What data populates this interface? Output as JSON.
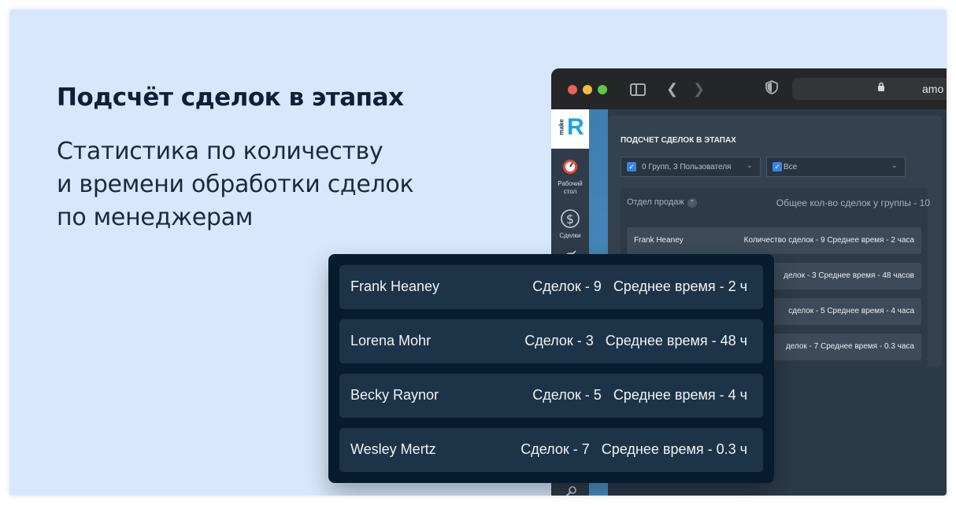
{
  "hero": {
    "title": "Подсчёт сделок в этапах",
    "subtitle_lines": [
      "Статистика по количеству",
      "и времени обработки сделок",
      "по менеджерам"
    ]
  },
  "browser": {
    "url": "amo",
    "nav": {
      "logo_prefix": "make",
      "logo_letter": "R",
      "items": [
        {
          "label": "Рабочий стол",
          "icon": "dashboard-icon"
        },
        {
          "label": "Сделки",
          "icon": "dollar-icon"
        }
      ]
    },
    "widget": {
      "title": "ПОДСЧЕТ СДЕЛОК В ЭТАПАХ",
      "filter_groups": "0 Групп, 3 Пользователя",
      "filter_all": "Все",
      "group_name": "Отдел продаж",
      "group_total": "Общее кол-во сделок у группы - 10",
      "rows": [
        {
          "name": "Frank Heaney",
          "stats": "Количество сделок - 9 Среднее время - 2 часа"
        },
        {
          "name": "",
          "stats": "делок - 3 Среднее время - 48 часов"
        },
        {
          "name": "",
          "stats": "сделок - 5 Среднее время - 4 часа"
        },
        {
          "name": "",
          "stats": "делок - 7 Среднее время - 0.3 часа"
        }
      ]
    }
  },
  "card": {
    "rows": [
      {
        "name": "Frank Heaney",
        "deals": "Сделок - 9",
        "time": "Среднее время - 2 ч"
      },
      {
        "name": "Lorena Mohr",
        "deals": "Сделок - 3",
        "time": "Среднее время - 48 ч"
      },
      {
        "name": "Becky Raynor",
        "deals": "Сделок - 5",
        "time": "Среднее время - 4 ч"
      },
      {
        "name": "Wesley Mertz",
        "deals": "Сделок - 7",
        "time": "Среднее время - 0.3 ч"
      }
    ]
  },
  "colors": {
    "background": "#d8e8fc",
    "card": "#071c2f",
    "card_row": "#1d3448",
    "accent": "#1aa2e6"
  }
}
